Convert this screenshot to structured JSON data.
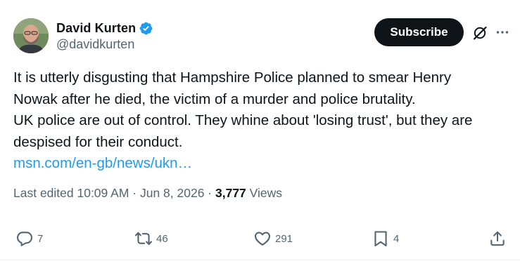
{
  "author": {
    "display_name": "David Kurten",
    "handle": "@davidkurten",
    "verified": true,
    "verified_color": "#1d9bf0"
  },
  "header": {
    "subscribe_label": "Subscribe",
    "grok_icon": "grok-icon",
    "more_icon": "more-options-icon"
  },
  "post": {
    "lines": [
      "It is utterly disgusting that Hampshire Police planned to smear Henry",
      "Nowak after he died, the victim of a murder and police brutality.",
      "UK police are out of control. They whine about 'losing trust', but they are",
      "despised for their conduct."
    ],
    "link_text": "msn.com/en-gb/news/ukn…",
    "link_color": "#1d9bf0"
  },
  "meta": {
    "edited_prefix": "Last edited 10:09 AM · Jun 8, 2026 · ",
    "views_count": "3,777",
    "views_label": " Views"
  },
  "actions": {
    "replies": "7",
    "reposts": "46",
    "likes": "291",
    "bookmarks": "4"
  },
  "colors": {
    "text_primary": "#0f1419",
    "text_secondary": "#536471",
    "button_bg": "#0f1419"
  }
}
